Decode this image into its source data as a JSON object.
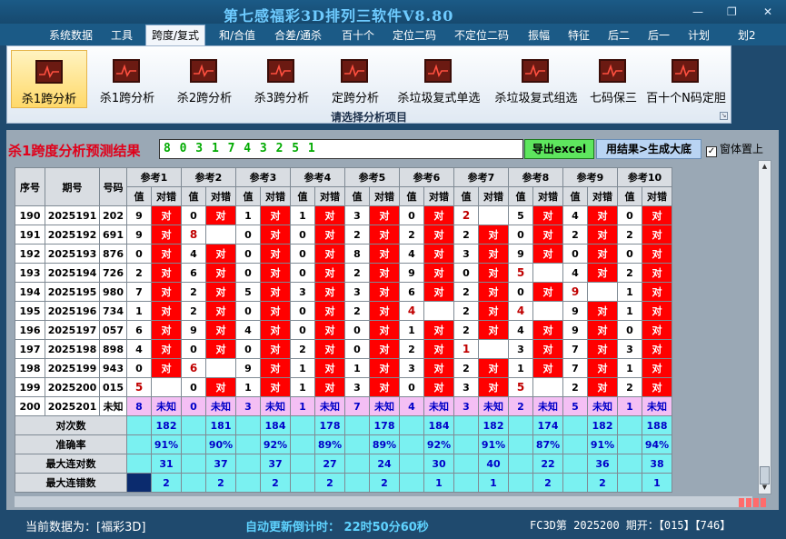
{
  "window": {
    "title": "第七感福彩3D排列三软件V8.80",
    "min": "—",
    "restore": "❐",
    "close": "✕"
  },
  "menu": [
    "系统数据",
    "工具",
    "跨度/复式",
    "和/合值",
    "合差/通杀",
    "百十个",
    "定位二码",
    "不定位二码",
    "振幅",
    "特征",
    "后二",
    "后一",
    "计划",
    "划2"
  ],
  "ribbon": {
    "buttons": [
      "杀1跨分析",
      "杀1跨分析",
      "杀2跨分析",
      "杀3跨分析",
      "定跨分析",
      "杀垃圾复式单选",
      "杀垃圾复式组选",
      "七码保三",
      "百十个N码定胆"
    ],
    "group_label": "请选择分析项目",
    "corner": "↘"
  },
  "panel": {
    "title": "杀1跨度分析预测结果",
    "result": "8 0 3 1 7 4 3 2 5 1",
    "export_btn": "导出excel",
    "generate_btn": "用结果>生成大底",
    "pin_label": "窗体置上",
    "pin_check": "✓"
  },
  "table": {
    "head_seq": "序号",
    "head_period": "期号",
    "head_num": "号码",
    "refs": [
      "参考1",
      "参考2",
      "参考3",
      "参考4",
      "参考5",
      "参考6",
      "参考7",
      "参考8",
      "参考9",
      "参考10"
    ],
    "sub_val": "值",
    "sub_mark": "对错",
    "rows": [
      {
        "seq": "190",
        "period": "2025191",
        "num": "202",
        "cells": [
          [
            "9",
            "对"
          ],
          [
            "0",
            "对"
          ],
          [
            "1",
            "对"
          ],
          [
            "1",
            "对"
          ],
          [
            "3",
            "对"
          ],
          [
            "0",
            "对"
          ],
          [
            "2",
            ""
          ],
          [
            "5",
            "对"
          ],
          [
            "4",
            "对"
          ],
          [
            "0",
            "对"
          ]
        ]
      },
      {
        "seq": "191",
        "period": "2025192",
        "num": "691",
        "cells": [
          [
            "9",
            "对"
          ],
          [
            "8",
            ""
          ],
          [
            "0",
            "对"
          ],
          [
            "0",
            "对"
          ],
          [
            "2",
            "对"
          ],
          [
            "2",
            "对"
          ],
          [
            "2",
            "对"
          ],
          [
            "0",
            "对"
          ],
          [
            "2",
            "对"
          ],
          [
            "2",
            "对"
          ]
        ]
      },
      {
        "seq": "192",
        "period": "2025193",
        "num": "876",
        "cells": [
          [
            "0",
            "对"
          ],
          [
            "4",
            "对"
          ],
          [
            "0",
            "对"
          ],
          [
            "0",
            "对"
          ],
          [
            "8",
            "对"
          ],
          [
            "4",
            "对"
          ],
          [
            "3",
            "对"
          ],
          [
            "9",
            "对"
          ],
          [
            "0",
            "对"
          ],
          [
            "0",
            "对"
          ]
        ]
      },
      {
        "seq": "193",
        "period": "2025194",
        "num": "726",
        "cells": [
          [
            "2",
            "对"
          ],
          [
            "6",
            "对"
          ],
          [
            "0",
            "对"
          ],
          [
            "0",
            "对"
          ],
          [
            "2",
            "对"
          ],
          [
            "9",
            "对"
          ],
          [
            "0",
            "对"
          ],
          [
            "5",
            ""
          ],
          [
            "4",
            "对"
          ],
          [
            "2",
            "对"
          ]
        ]
      },
      {
        "seq": "194",
        "period": "2025195",
        "num": "980",
        "cells": [
          [
            "7",
            "对"
          ],
          [
            "2",
            "对"
          ],
          [
            "5",
            "对"
          ],
          [
            "3",
            "对"
          ],
          [
            "3",
            "对"
          ],
          [
            "6",
            "对"
          ],
          [
            "2",
            "对"
          ],
          [
            "0",
            "对"
          ],
          [
            "9",
            ""
          ],
          [
            "1",
            "对"
          ]
        ]
      },
      {
        "seq": "195",
        "period": "2025196",
        "num": "734",
        "cells": [
          [
            "1",
            "对"
          ],
          [
            "2",
            "对"
          ],
          [
            "0",
            "对"
          ],
          [
            "0",
            "对"
          ],
          [
            "2",
            "对"
          ],
          [
            "4",
            ""
          ],
          [
            "2",
            "对"
          ],
          [
            "4",
            ""
          ],
          [
            "9",
            "对"
          ],
          [
            "1",
            "对"
          ]
        ]
      },
      {
        "seq": "196",
        "period": "2025197",
        "num": "057",
        "cells": [
          [
            "6",
            "对"
          ],
          [
            "9",
            "对"
          ],
          [
            "4",
            "对"
          ],
          [
            "0",
            "对"
          ],
          [
            "0",
            "对"
          ],
          [
            "1",
            "对"
          ],
          [
            "2",
            "对"
          ],
          [
            "4",
            "对"
          ],
          [
            "9",
            "对"
          ],
          [
            "0",
            "对"
          ]
        ]
      },
      {
        "seq": "197",
        "period": "2025198",
        "num": "898",
        "cells": [
          [
            "4",
            "对"
          ],
          [
            "0",
            "对"
          ],
          [
            "0",
            "对"
          ],
          [
            "2",
            "对"
          ],
          [
            "0",
            "对"
          ],
          [
            "2",
            "对"
          ],
          [
            "1",
            ""
          ],
          [
            "3",
            "对"
          ],
          [
            "7",
            "对"
          ],
          [
            "3",
            "对"
          ]
        ]
      },
      {
        "seq": "198",
        "period": "2025199",
        "num": "943",
        "cells": [
          [
            "0",
            "对"
          ],
          [
            "6",
            ""
          ],
          [
            "9",
            "对"
          ],
          [
            "1",
            "对"
          ],
          [
            "1",
            "对"
          ],
          [
            "3",
            "对"
          ],
          [
            "2",
            "对"
          ],
          [
            "1",
            "对"
          ],
          [
            "7",
            "对"
          ],
          [
            "1",
            "对"
          ]
        ]
      },
      {
        "seq": "199",
        "period": "2025200",
        "num": "015",
        "cells": [
          [
            "5",
            ""
          ],
          [
            "0",
            "对"
          ],
          [
            "1",
            "对"
          ],
          [
            "1",
            "对"
          ],
          [
            "3",
            "对"
          ],
          [
            "0",
            "对"
          ],
          [
            "3",
            "对"
          ],
          [
            "5",
            ""
          ],
          [
            "2",
            "对"
          ],
          [
            "2",
            "对"
          ]
        ]
      },
      {
        "seq": "200",
        "period": "2025201",
        "num": "未知",
        "cells": [
          [
            "8",
            "未知"
          ],
          [
            "0",
            "未知"
          ],
          [
            "3",
            "未知"
          ],
          [
            "1",
            "未知"
          ],
          [
            "7",
            "未知"
          ],
          [
            "4",
            "未知"
          ],
          [
            "3",
            "未知"
          ],
          [
            "2",
            "未知"
          ],
          [
            "5",
            "未知"
          ],
          [
            "1",
            "未知"
          ]
        ]
      }
    ],
    "stats": [
      {
        "label": "对次数",
        "values": [
          "182",
          "181",
          "184",
          "178",
          "178",
          "184",
          "182",
          "174",
          "182",
          "188"
        ]
      },
      {
        "label": "准确率",
        "values": [
          "91%",
          "90%",
          "92%",
          "89%",
          "89%",
          "92%",
          "91%",
          "87%",
          "91%",
          "94%"
        ]
      },
      {
        "label": "最大连对数",
        "values": [
          "31",
          "37",
          "37",
          "27",
          "24",
          "30",
          "40",
          "22",
          "36",
          "38"
        ]
      },
      {
        "label": "最大连错数",
        "values": [
          "2",
          "2",
          "2",
          "2",
          "2",
          "1",
          "1",
          "2",
          "2",
          "1"
        ]
      }
    ]
  },
  "status": {
    "current": "当前数据为：[福彩3D]",
    "countdown": "自动更新倒计时：  22时50分60秒",
    "draw": "FC3D第 2025200 期开：【015】【746】"
  },
  "colors": {
    "hit": "#ff0000",
    "pink": "#f4bff4",
    "cyan": "#7af1f1",
    "status_cyan": "#5fd3ff",
    "status_white": "#ffffff"
  }
}
